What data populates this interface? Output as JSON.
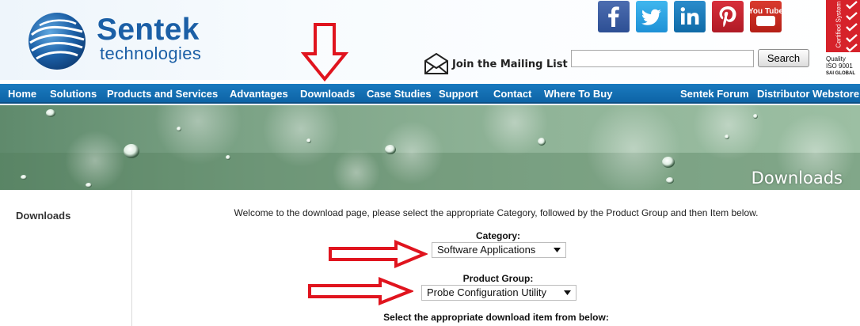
{
  "header": {
    "logo_name": "Sentek",
    "logo_sub": "technologies",
    "mailing_label": "Join the Mailing List",
    "search_placeholder": "",
    "search_label": "Search",
    "social": [
      "facebook-icon",
      "twitter-icon",
      "linkedin-icon",
      "pinterest-icon",
      "youtube-icon"
    ],
    "youtube_text": "You Tube",
    "certification": {
      "band_text": "Certified System",
      "line1": "Quality",
      "line2": "ISO 9001",
      "line3": "SAI GLOBAL"
    }
  },
  "nav": {
    "items": [
      "Home",
      "Solutions",
      "Products and Services",
      "Advantages",
      "Downloads",
      "Case Studies",
      "Support",
      "Contact",
      "Where To Buy"
    ],
    "right_items": [
      "Sentek Forum",
      "Distributor Webstore"
    ]
  },
  "banner": {
    "title": "Downloads"
  },
  "sidebar": {
    "link": "Downloads"
  },
  "main": {
    "welcome": "Welcome to the download page, please select the appropriate Category, followed by the Product Group and then Item below.",
    "category": {
      "label": "Category:",
      "selected": "Software Applications"
    },
    "product_group": {
      "label": "Product Group:",
      "selected": "Probe Configuration Utility"
    },
    "instruction": "Select the appropriate download item from below:"
  },
  "colors": {
    "brand_blue": "#1b5fa6",
    "nav_blue": "#0d64a6",
    "annotation_red": "#e0141e"
  }
}
